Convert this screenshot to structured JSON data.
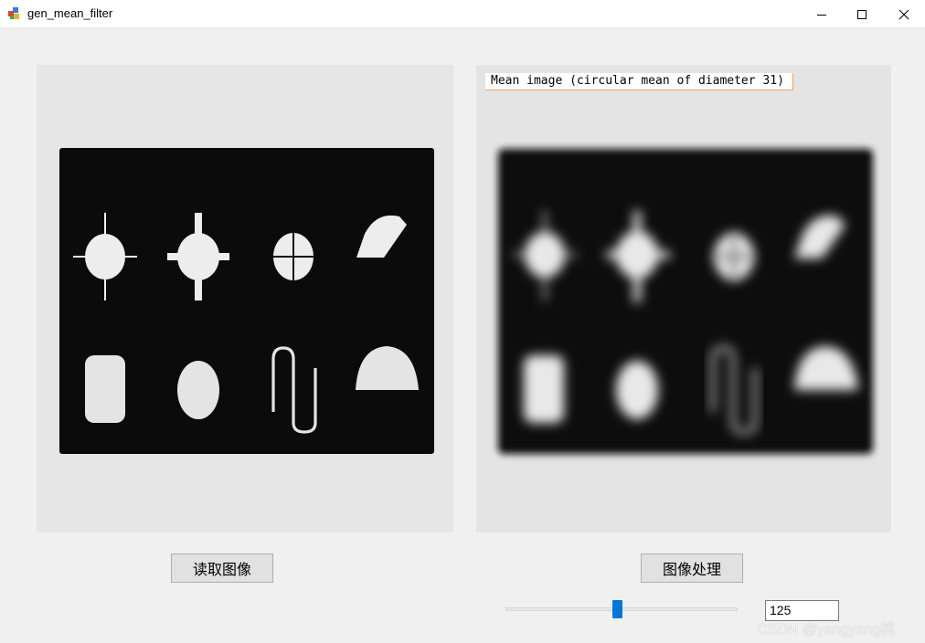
{
  "window": {
    "title": "gen_mean_filter",
    "app_icon": "halcon-app-icon",
    "controls": {
      "minimize": "minimize-icon",
      "maximize": "maximize-icon",
      "close": "close-icon"
    }
  },
  "left_image": {
    "description_name": "original-image",
    "background_color": "#e6e6e6",
    "board_color": "#0b0b0b"
  },
  "right_image": {
    "overlay_text": "Mean image (circular mean of diameter 31)",
    "background_color": "#e2e2e2",
    "board_color": "#0d0d0d"
  },
  "buttons": {
    "read_label": "读取图像",
    "process_label": "图像处理"
  },
  "slider": {
    "value_fraction": 0.48,
    "accent": "#0078d7"
  },
  "value_field": {
    "value": "125"
  },
  "watermark": {
    "text": "CSDN @yangyang桃"
  }
}
